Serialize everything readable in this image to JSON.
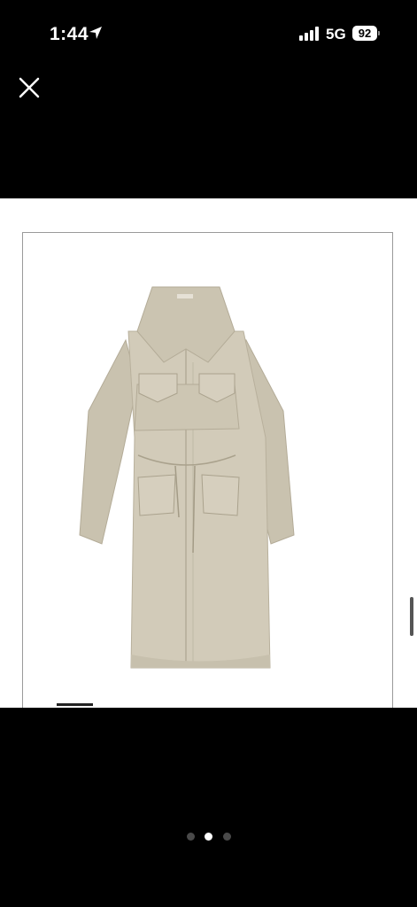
{
  "status_bar": {
    "time": "1:44",
    "network": "5G",
    "battery": "92",
    "icons": [
      "location-arrow-icon",
      "signal-bars-icon",
      "battery-icon"
    ]
  },
  "toolbar": {
    "close_icon": "close-icon"
  },
  "viewer": {
    "current_image": 2,
    "total_images": 3
  },
  "colors": {
    "background": "#000000",
    "image_bg": "#ffffff",
    "coat": "#cfc8b6",
    "coat_shadow": "#b8b09c"
  }
}
